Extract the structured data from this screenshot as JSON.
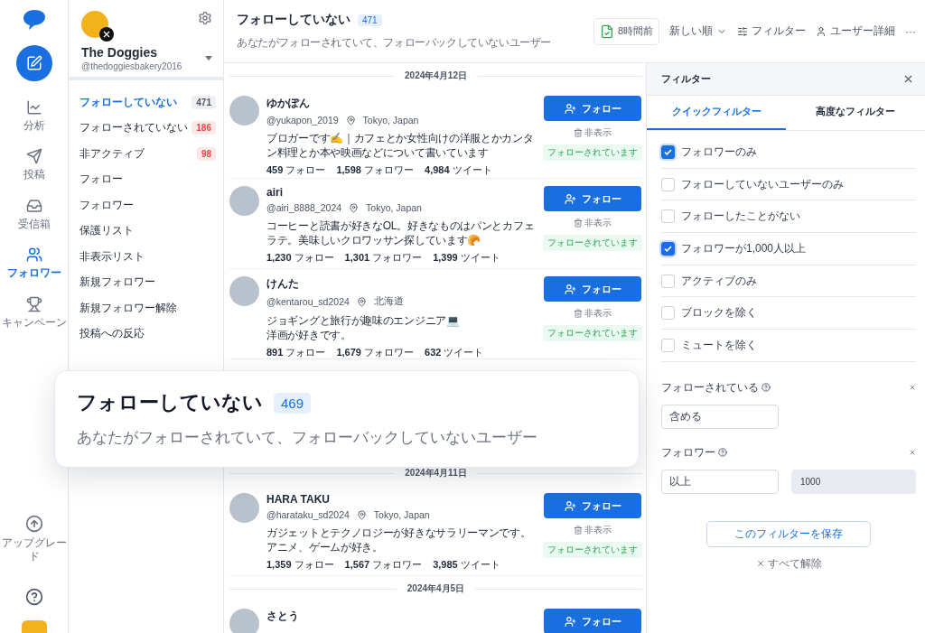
{
  "rail": {
    "items": [
      {
        "label": "分析",
        "kind": "chart",
        "selected": false
      },
      {
        "label": "投稿",
        "kind": "send",
        "selected": false
      },
      {
        "label": "受信箱",
        "kind": "inbox",
        "selected": false
      },
      {
        "label": "フォロワー",
        "kind": "users",
        "selected": true
      },
      {
        "label": "キャンペーン",
        "kind": "trophy",
        "selected": false
      }
    ],
    "upgrade": "アップグレード"
  },
  "account": {
    "name": "The Doggies",
    "handle": "@thedoggiesbakery2016"
  },
  "sidebar": {
    "items": [
      {
        "label": "フォローしていない",
        "count": "471",
        "color": "#4b5563",
        "selected": true
      },
      {
        "label": "フォローされていない",
        "count": "186",
        "color": "#e5484d",
        "selected": false
      },
      {
        "label": "非アクティブ",
        "count": "98",
        "color": "#e5484d",
        "selected": false
      },
      {
        "label": "フォロー",
        "selected": false
      },
      {
        "label": "フォロワー",
        "selected": false
      },
      {
        "label": "保護リスト",
        "selected": false
      },
      {
        "label": "非表示リスト",
        "selected": false
      },
      {
        "label": "新規フォロワー",
        "selected": false
      },
      {
        "label": "新規フォロワー解除",
        "selected": false
      },
      {
        "label": "投稿への反応",
        "selected": false
      }
    ]
  },
  "header": {
    "title": "フォローしていない",
    "count": "471",
    "subtitle": "あなたがフォローされていて、フォローバックしていないユーザー",
    "export": "8時間前",
    "sort": "新しい順",
    "filter": "フィルター",
    "details": "ユーザー詳細",
    "more": "···"
  },
  "groups": [
    {
      "date": "2024年4月12日",
      "users": [
        {
          "name": "ゆかぽん",
          "handle": "@yukapon_2019",
          "location": "Tokyo, Japan",
          "bio": [
            "ブロガーです✍️｜カフェとか女性向けの洋服とかカンタン料理とか本や映画などについて書いています"
          ],
          "stats": [
            "**459** フォロー",
            "**1,598** フォロワー",
            "**4,984** ツイート"
          ],
          "follow": "フォロー",
          "hide": "非表示",
          "status": "フォローされています"
        },
        {
          "name": "airi",
          "handle": "@airi_8888_2024",
          "location": "Tokyo, Japan",
          "bio": [
            " コーヒーと読書が好きなOL。好きなものはパンとカフェラテ。美味しいクロワッサン探しています🥐"
          ],
          "stats": [
            "**1,230** フォロー",
            "**1,301** フォロワー",
            "**1,399** ツイート"
          ],
          "follow": "フォロー",
          "hide": "非表示",
          "status": "フォローされています"
        },
        {
          "name": "けんた",
          "handle": "@kentarou_sd2024",
          "location": "北海道",
          "bio": [
            "ジョギングと旅行が趣味のエンジニア💻",
            "洋画が好きです。"
          ],
          "stats": [
            "**891** フォロー",
            "**1,679** フォロワー",
            "**632** ツイート"
          ],
          "follow": "フォロー",
          "hide": "非表示",
          "status": "フォローされています"
        }
      ]
    },
    {
      "date": "2024年4月11日",
      "users": [
        {
          "name": "HARA TAKU",
          "handle": "@harataku_sd2024",
          "location": "Tokyo, Japan",
          "bio": [
            "ガジェットとテクノロジーが好きなサラリーマンです。",
            "アニメ、ゲームが好き。"
          ],
          "stats": [
            "**1,359** フォロー",
            "**1,567** フォロワー",
            "**3,985** ツイート"
          ],
          "follow": "フォロー",
          "hide": "非表示",
          "status": "フォローされています"
        }
      ]
    },
    {
      "date": "2024年4月5日",
      "users": [
        {
          "name": "さとう",
          "follow": "フォロー"
        }
      ]
    }
  ],
  "filter_panel": {
    "title": "フィルター",
    "tabs": [
      {
        "label": "クイックフィルター",
        "selected": true
      },
      {
        "label": "高度なフィルター",
        "selected": false
      }
    ],
    "options": [
      {
        "label": "フォロワーのみ",
        "checked": true
      },
      {
        "label": "フォローしていないユーザーのみ",
        "checked": false
      },
      {
        "label": "フォローしたことがない",
        "checked": false
      },
      {
        "label": "フォロワーが1,000人以上",
        "checked": true
      },
      {
        "label": "アクティブのみ",
        "checked": false
      },
      {
        "label": "ブロックを除く",
        "checked": false
      },
      {
        "label": "ミュートを除く",
        "checked": false
      }
    ],
    "fields": [
      {
        "label": "フォローされている",
        "select": "含める"
      },
      {
        "label": "フォロワー",
        "select": "以上",
        "value": "1000"
      }
    ],
    "save": "このフィルターを保存",
    "clear": "すべて解除"
  },
  "callout": {
    "title": "フォローしていない",
    "count": "469",
    "subtitle": "あなたがフォローされていて、フォローバックしていないユーザー"
  }
}
